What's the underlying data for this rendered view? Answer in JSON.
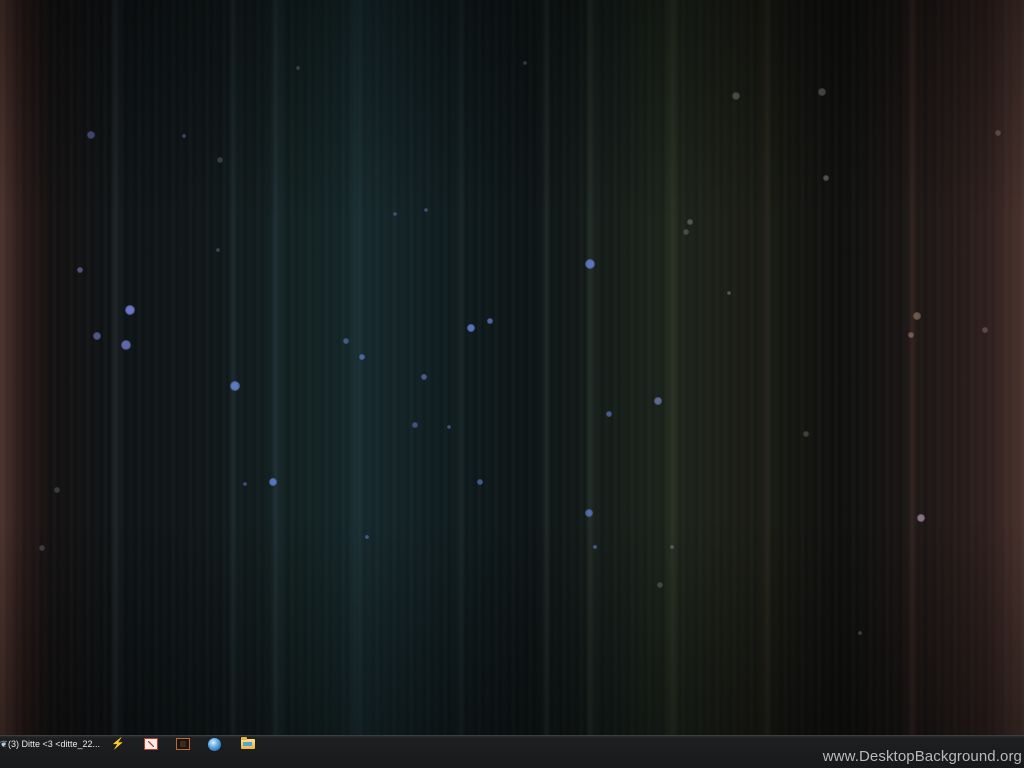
{
  "desktop": {
    "wallpaper": "dark-vertical-light-streaks-with-bokeh"
  },
  "taskbar": {
    "window_title": "(3) Ditte <3 <ditte_22...",
    "window_icon": "pin-icon",
    "quick_launch": [
      {
        "name": "lightning-app-icon"
      },
      {
        "name": "pdf-document-icon"
      },
      {
        "name": "dark-app-icon"
      },
      {
        "name": "internet-globe-icon"
      },
      {
        "name": "folder-icon"
      }
    ]
  },
  "watermark": {
    "text": "www.DesktopBackground.org"
  },
  "colors": {
    "taskbar_bg": "#18191a",
    "taskbar_text": "#e9ecee",
    "watermark_text": "#b8babb"
  }
}
